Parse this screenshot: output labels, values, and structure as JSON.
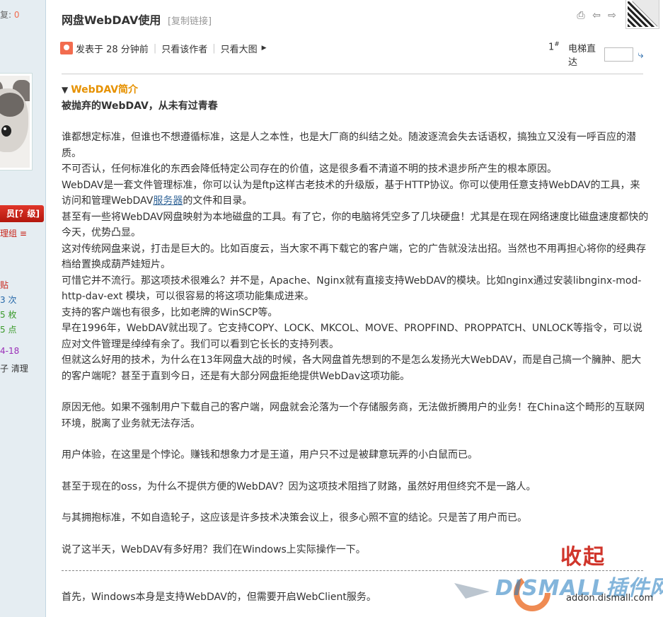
{
  "sidebar": {
    "reply_label": "复:",
    "reply_count": "0",
    "badge_label": "员[？级]",
    "group_label": "理组 ≡",
    "stat_posts": "贴",
    "stat_visits": "3 次",
    "stat_coins": "5 枚",
    "stat_points": "5 点",
    "date": "4-18",
    "actions": "子 清理"
  },
  "post": {
    "title": "网盘WebDAV使用",
    "copy_link": "[复制链接]",
    "posted_at": "发表于 28 分钟前",
    "only_author": "只看该作者",
    "only_big_image": "只看大图",
    "floor_number": "1",
    "floor_mark": "#",
    "jump_label": "电梯直达",
    "spoiler_title": "WebDAV简介",
    "subtitle": "被抛弃的WebDAV，从未有过青春",
    "p1": "谁都想定标准，但谁也不想遵循标准，这是人之本性，也是大厂商的纠结之处。随波逐流会失去话语权，搞独立又没有一呼百应的潜质。",
    "p2": "不可否认，任何标准化的东西会降低特定公司存在的价值，这是很多看不清道不明的技术退步所产生的根本原因。",
    "p3a": "WebDAV是一套文件管理标准，你可以认为是ftp这样古老技术的升级版，基于HTTP协议。你可以使用任意支持WebDAV的工具，来访问和管理WebDAV",
    "p3_link": "服务器",
    "p3b": "的文件和目录。",
    "p4": "甚至有一些将WebDAV网盘映射为本地磁盘的工具。有了它，你的电脑将凭空多了几块硬盘！尤其是在现在网络速度比磁盘速度都快的今天，优势凸显。",
    "p5": "这对传统网盘来说，打击是巨大的。比如百度云，当大家不再下载它的客户端，它的广告就没法出招。当然也不用再担心将你的经典存档给置换成葫芦娃短片。",
    "p6": "可惜它并不流行。那这项技术很难么？并不是，Apache、Nginx就有直接支持WebDAV的模块。比如nginx通过安装libnginx-mod-http-dav-ext 模块，可以很容易的将这项功能集成进来。",
    "p7": "支持的客户端也有很多，比如老牌的WinSCP等。",
    "p8": "早在1996年，WebDAV就出现了。它支持COPY、LOCK、MKCOL、MOVE、PROPFIND、PROPPATCH、UNLOCK等指令，可以说应对文件管理是绰绰有余了。我们可以看到它长长的支持列表。",
    "p9": "但就这么好用的技术，为什么在13年网盘大战的时候，各大网盘首先想到的不是怎么发扬光大WebDAV，而是自己搞一个臃肿、肥大的客户端呢？甚至于直到今日，还是有大部分网盘拒绝提供WebDav这项功能。",
    "p10": "原因无他。如果不强制用户下载自己的客户端，网盘就会沦落为一个存储服务商，无法做折腾用户的业务！在China这个畸形的互联网环境，脱离了业务就无法存活。",
    "p11": "用户体验，在这里是个悖论。赚钱和想象力才是王道，用户只不过是被肆意玩弄的小白鼠而已。",
    "p12": "甚至于现在的oss，为什么不提供方便的WebDAV？因为这项技术阻挡了财路，虽然好用但终究不是一路人。",
    "p13": "与其拥抱标准，不如自造轮子，这应该是许多技术决策会议上，很多心照不宣的结论。只是苦了用户而已。",
    "p14": "说了这半天，WebDAV有多好用？我们在Windows上实际操作一下。",
    "p15": "首先，Windows本身是支持WebDAV的，但需要开启WebClient服务。"
  },
  "watermark": {
    "collapse": "收起",
    "brand": "DISMALL插件网",
    "url": "addon.dismall.com"
  },
  "colors": {
    "accent_orange": "#e69100",
    "badge_red": "#c9251a",
    "link_blue": "#336699"
  }
}
